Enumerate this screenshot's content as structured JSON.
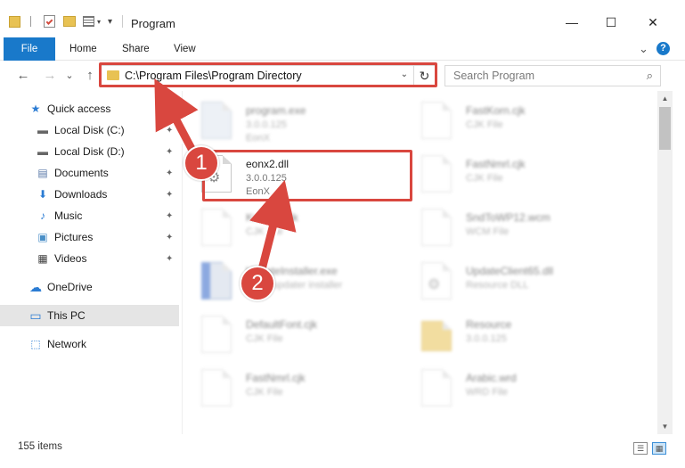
{
  "window": {
    "title": "Program",
    "minimize": "—",
    "maximize": "☐",
    "close": "✕"
  },
  "ribbon": {
    "tabs": [
      "File",
      "Home",
      "Share",
      "View"
    ],
    "expand": "⌄",
    "help": "?"
  },
  "nav": {
    "back": "←",
    "forward": "→",
    "recent": "⌄",
    "up": "↑"
  },
  "address": {
    "path": "C:\\Program Files\\Program Directory",
    "dropdown": "⌄",
    "refresh": "↻"
  },
  "search": {
    "placeholder": "Search Program",
    "icon": "⌕"
  },
  "sidebar": {
    "items": [
      {
        "label": "Quick access",
        "icon": "star-icon",
        "glyph": "★"
      },
      {
        "label": "Local Disk (C:)",
        "icon": "drive-icon",
        "glyph": "▬"
      },
      {
        "label": "Local Disk (D:)",
        "icon": "drive-icon",
        "glyph": "▬"
      },
      {
        "label": "Documents",
        "icon": "documents-icon",
        "glyph": "▤"
      },
      {
        "label": "Downloads",
        "icon": "download-icon",
        "glyph": "⬇"
      },
      {
        "label": "Music",
        "icon": "music-icon",
        "glyph": "♪"
      },
      {
        "label": "Pictures",
        "icon": "pictures-icon",
        "glyph": "▣"
      },
      {
        "label": "Videos",
        "icon": "videos-icon",
        "glyph": "▦"
      },
      {
        "label": "OneDrive",
        "icon": "cloud-icon",
        "glyph": "☁"
      },
      {
        "label": "This PC",
        "icon": "computer-icon",
        "glyph": "▭"
      },
      {
        "label": "Network",
        "icon": "network-icon",
        "glyph": "⬚"
      }
    ],
    "pin_glyph": "📌"
  },
  "files": {
    "left": [
      {
        "name": "program.exe",
        "line1": "3.0.0.125",
        "line2": "EonX",
        "kind": "exe"
      },
      {
        "name": "eonx2.dll",
        "line1": "3.0.0.125",
        "line2": "EonX",
        "kind": "dll"
      },
      {
        "name": "Kontakt.cjk",
        "line1": "CJK File",
        "line2": "",
        "kind": "doc"
      },
      {
        "name": "UpdateInstaller.exe",
        "line1": "EonX updater installer",
        "line2": "",
        "kind": "inst"
      },
      {
        "name": "DefaultFont.cjk",
        "line1": "CJK File",
        "line2": "",
        "kind": "doc"
      },
      {
        "name": "FastNmrl.cjk",
        "line1": "CJK File",
        "line2": "",
        "kind": "doc"
      }
    ],
    "right": [
      {
        "name": "FastKorn.cjk",
        "line1": "CJK File",
        "line2": "",
        "kind": "doc"
      },
      {
        "name": "FastNmrl.cjk",
        "line1": "CJK File",
        "line2": "",
        "kind": "doc"
      },
      {
        "name": "SndToWP12.wcm",
        "line1": "WCM File",
        "line2": "",
        "kind": "doc"
      },
      {
        "name": "UpdateClient65.dll",
        "line1": "Resource DLL",
        "line2": "",
        "kind": "dll"
      },
      {
        "name": "Resource",
        "line1": "3.0.0.125",
        "line2": "",
        "kind": "folder"
      },
      {
        "name": "Arabic.wrd",
        "line1": "WRD File",
        "line2": "",
        "kind": "doc"
      }
    ]
  },
  "status": {
    "count": "155 items",
    "details_view": "☰",
    "icons_view": "▦"
  },
  "callouts": {
    "step1": "1",
    "step2": "2"
  },
  "scroll": {
    "up": "▲",
    "down": "▼"
  }
}
